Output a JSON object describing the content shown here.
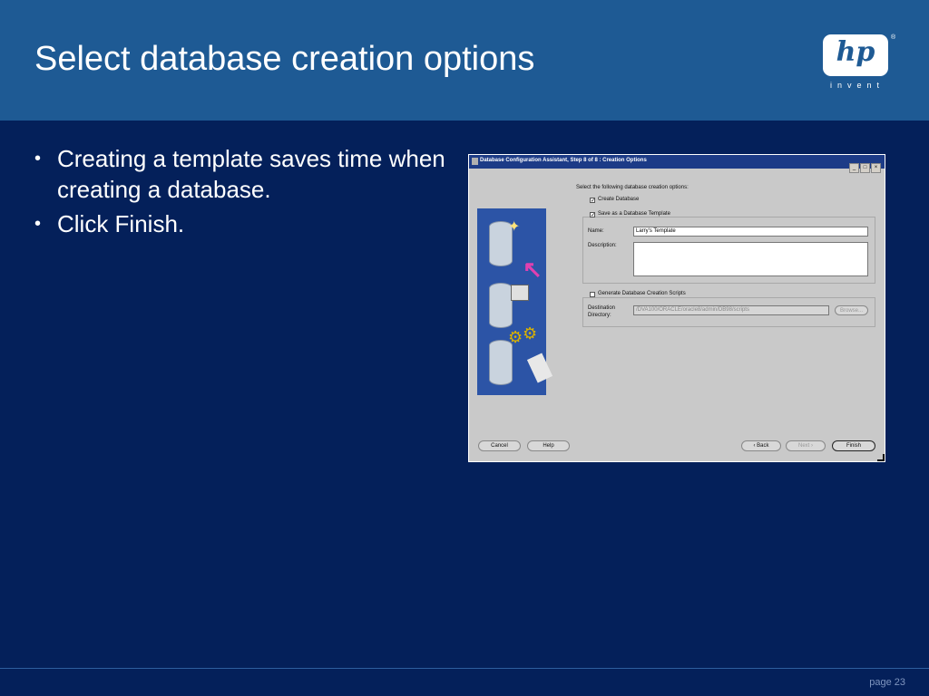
{
  "slide": {
    "title": "Select database creation options",
    "bullets": [
      "Creating a template saves time when creating a database.",
      "Click Finish."
    ],
    "page_label": "page 23",
    "colors": {
      "background": "#04205a",
      "header": "#1e5a94",
      "text": "#ffffff"
    }
  },
  "logo": {
    "brand": "hp",
    "tagline": "invent",
    "reg": "®"
  },
  "dialog": {
    "title": "Database Configuration Assistant, Step 8 of 8 : Creation Options",
    "instruction": "Select the following database creation options:",
    "create_db": {
      "label": "Create Database",
      "checked": true
    },
    "save_template": {
      "label": "Save as a Database Template",
      "checked": true
    },
    "name_label": "Name:",
    "name_value": "Larry's Template",
    "description_label": "Description:",
    "description_value": "",
    "gen_scripts": {
      "label": "Generate Database Creation Scripts",
      "checked": false
    },
    "dest_label_1": "Destination",
    "dest_label_2": "Directory:",
    "dest_value": "/DVA100/ORACLE/oracle8/admin/DB98/scripts",
    "browse": "Browse...",
    "buttons": {
      "cancel": "Cancel",
      "help": "Help",
      "back": "Back",
      "next": "Next",
      "finish": "Finish"
    }
  }
}
